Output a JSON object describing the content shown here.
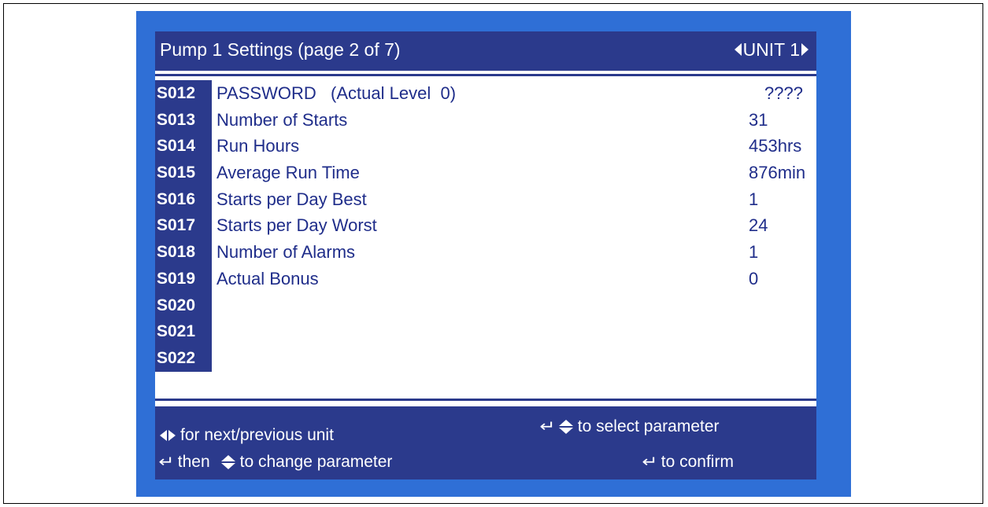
{
  "header": {
    "title": "Pump 1 Settings (page 2 of 7)",
    "unit_label": "UNIT 1",
    "prev_unit_icon": "triangle-left-icon",
    "next_unit_icon": "triangle-right-icon"
  },
  "parameters": [
    {
      "code": "S012",
      "label": "PASSWORD   (Actual Level  0)",
      "value": "????"
    },
    {
      "code": "S013",
      "label": "Number of Starts",
      "value": "31"
    },
    {
      "code": "S014",
      "label": "Run Hours",
      "value": "453hrs"
    },
    {
      "code": "S015",
      "label": "Average Run Time",
      "value": "876min"
    },
    {
      "code": "S016",
      "label": "Starts per Day Best",
      "value": "1"
    },
    {
      "code": "S017",
      "label": "Starts per Day Worst",
      "value": "24"
    },
    {
      "code": "S018",
      "label": "Number of Alarms",
      "value": "1"
    },
    {
      "code": "S019",
      "label": "Actual Bonus",
      "value": "0"
    },
    {
      "code": "S020",
      "label": "",
      "value": ""
    },
    {
      "code": "S021",
      "label": "",
      "value": ""
    },
    {
      "code": "S022",
      "label": "",
      "value": ""
    }
  ],
  "footer": {
    "next_prev_unit": "for next/previous unit",
    "then_text": "then",
    "change_parameter": "to change parameter",
    "select_parameter": "to select parameter",
    "confirm": "to confirm",
    "icons": [
      "left-right-arrows-icon",
      "enter-icon",
      "up-down-arrows-icon"
    ]
  },
  "colors": {
    "bezel": "#2f6fd6",
    "bar": "#2b3a8c",
    "text": "#1f2d8a",
    "screen": "#ffffff"
  }
}
